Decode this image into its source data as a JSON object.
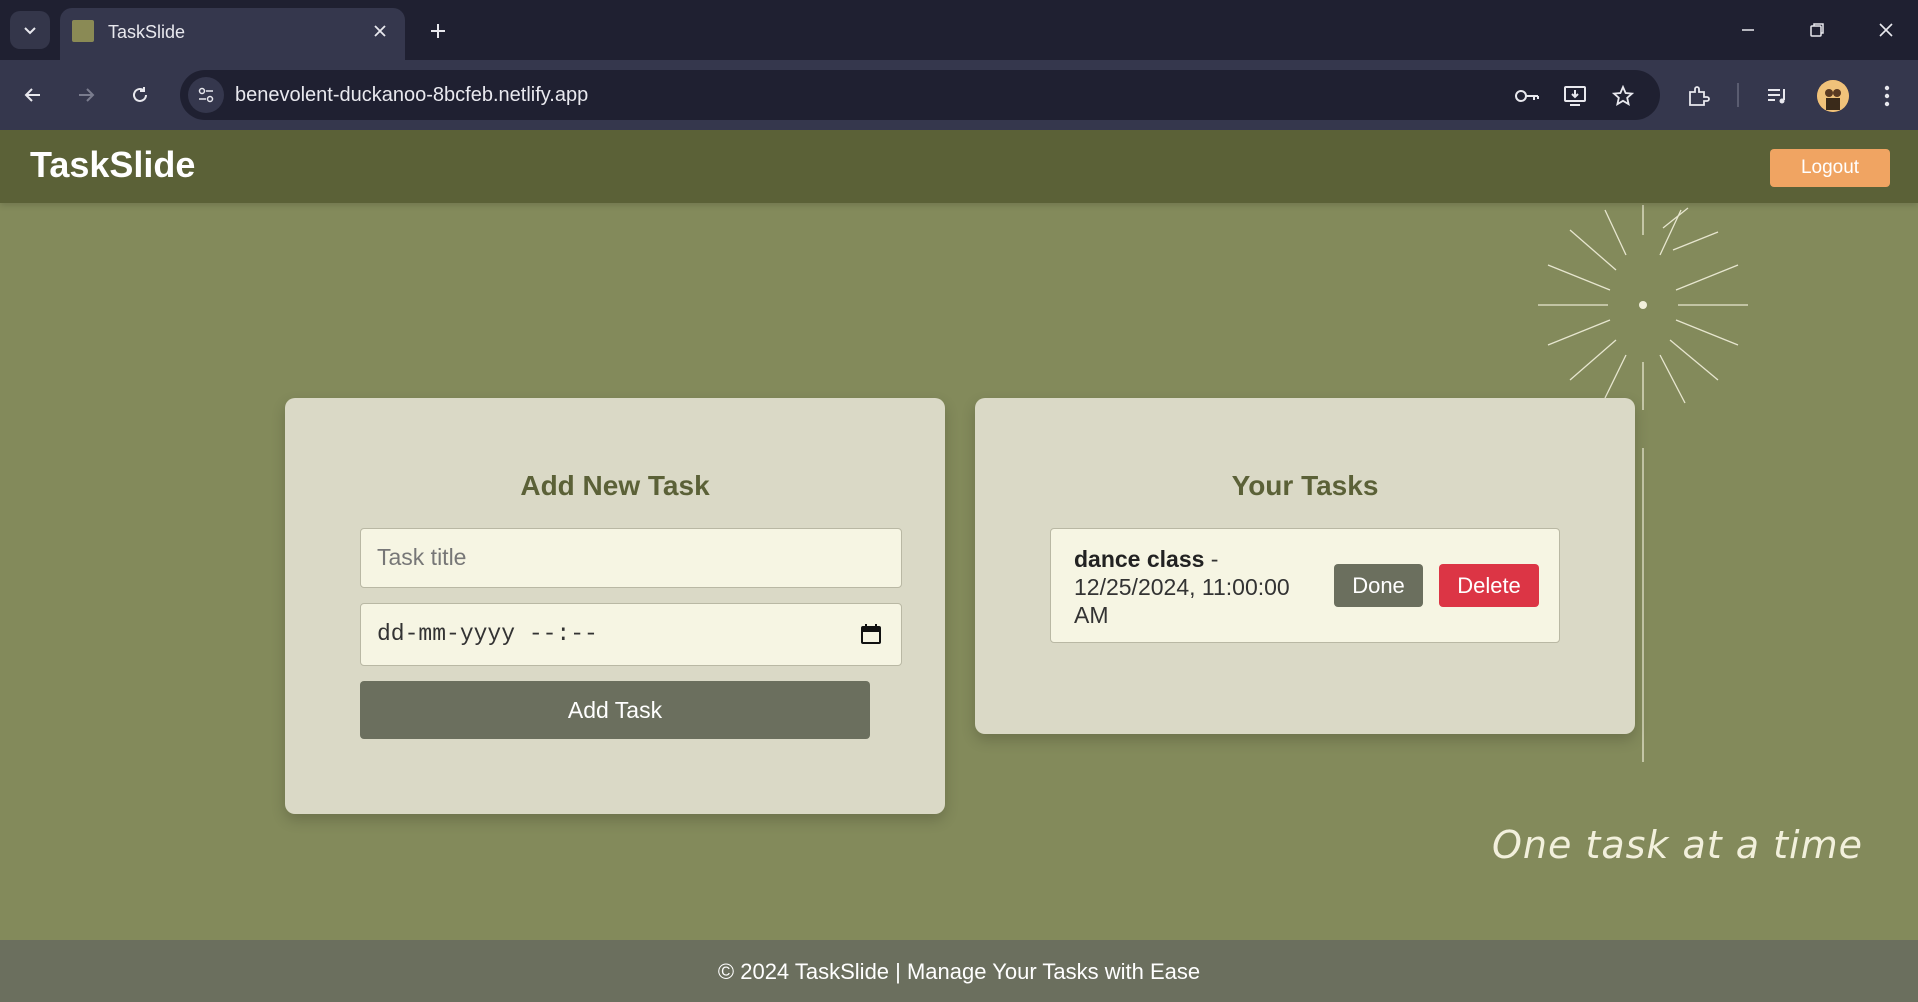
{
  "browser": {
    "tab_title": "TaskSlide",
    "url": "benevolent-duckanoo-8bcfeb.netlify.app"
  },
  "header": {
    "brand": "TaskSlide",
    "logout_label": "Logout"
  },
  "add_task": {
    "title": "Add New Task",
    "title_placeholder": "Task title",
    "datetime_placeholder": "dd-mm-yyyy --:--",
    "add_button": "Add Task"
  },
  "tasks": {
    "title": "Your Tasks",
    "items": [
      {
        "name": "dance class",
        "separator": " - ",
        "due": "12/25/2024, 11:00:00 AM",
        "done_label": "Done",
        "delete_label": "Delete"
      }
    ]
  },
  "tagline": "One task at a time",
  "footer": {
    "text": "© 2024 TaskSlide | Manage Your Tasks with Ease"
  },
  "colors": {
    "page_bg": "#838a5b",
    "header_bg": "#5b6137",
    "card_bg": "#dad9c6",
    "logout": "#f0a462",
    "delete": "#dc3545",
    "neutral_button": "#6b6f5e"
  }
}
